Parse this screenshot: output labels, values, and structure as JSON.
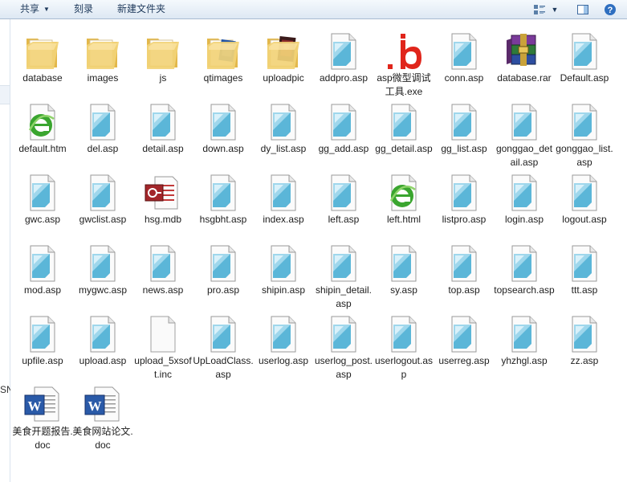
{
  "toolbar": {
    "share_label": "共享",
    "burn_label": "刻录",
    "new_folder_label": "新建文件夹"
  },
  "nav": {
    "fragment_text": "SN"
  },
  "files": [
    {
      "name": "database",
      "icon": "folder-icon"
    },
    {
      "name": "images",
      "icon": "folder-icon"
    },
    {
      "name": "js",
      "icon": "folder-icon"
    },
    {
      "name": "qtimages",
      "icon": "folder-image-icon"
    },
    {
      "name": "uploadpic",
      "icon": "folder-photo-icon"
    },
    {
      "name": "addpro.asp",
      "icon": "asp-file-icon"
    },
    {
      "name": "asp微型调试工具.exe",
      "icon": "exe-b-icon"
    },
    {
      "name": "conn.asp",
      "icon": "asp-file-icon"
    },
    {
      "name": "database.rar",
      "icon": "rar-archive-icon"
    },
    {
      "name": "Default.asp",
      "icon": "asp-file-icon"
    },
    {
      "name": "default.htm",
      "icon": "html-ie-icon"
    },
    {
      "name": "del.asp",
      "icon": "asp-file-icon"
    },
    {
      "name": "detail.asp",
      "icon": "asp-file-icon"
    },
    {
      "name": "down.asp",
      "icon": "asp-file-icon"
    },
    {
      "name": "dy_list.asp",
      "icon": "asp-file-icon"
    },
    {
      "name": "gg_add.asp",
      "icon": "asp-file-icon"
    },
    {
      "name": "gg_detail.asp",
      "icon": "asp-file-icon"
    },
    {
      "name": "gg_list.asp",
      "icon": "asp-file-icon"
    },
    {
      "name": "gonggao_detail.asp",
      "icon": "asp-file-icon"
    },
    {
      "name": "gonggao_list.asp",
      "icon": "asp-file-icon"
    },
    {
      "name": "gwc.asp",
      "icon": "asp-file-icon"
    },
    {
      "name": "gwclist.asp",
      "icon": "asp-file-icon"
    },
    {
      "name": "hsg.mdb",
      "icon": "access-mdb-icon"
    },
    {
      "name": "hsgbht.asp",
      "icon": "asp-file-icon"
    },
    {
      "name": "index.asp",
      "icon": "asp-file-icon"
    },
    {
      "name": "left.asp",
      "icon": "asp-file-icon"
    },
    {
      "name": "left.html",
      "icon": "html-ie-icon"
    },
    {
      "name": "listpro.asp",
      "icon": "asp-file-icon"
    },
    {
      "name": "login.asp",
      "icon": "asp-file-icon"
    },
    {
      "name": "logout.asp",
      "icon": "asp-file-icon"
    },
    {
      "name": "mod.asp",
      "icon": "asp-file-icon"
    },
    {
      "name": "mygwc.asp",
      "icon": "asp-file-icon"
    },
    {
      "name": "news.asp",
      "icon": "asp-file-icon"
    },
    {
      "name": "pro.asp",
      "icon": "asp-file-icon"
    },
    {
      "name": "shipin.asp",
      "icon": "asp-file-icon"
    },
    {
      "name": "shipin_detail.asp",
      "icon": "asp-file-icon"
    },
    {
      "name": "sy.asp",
      "icon": "asp-file-icon"
    },
    {
      "name": "top.asp",
      "icon": "asp-file-icon"
    },
    {
      "name": "topsearch.asp",
      "icon": "asp-file-icon"
    },
    {
      "name": "ttt.asp",
      "icon": "asp-file-icon"
    },
    {
      "name": "upfile.asp",
      "icon": "asp-file-icon"
    },
    {
      "name": "upload.asp",
      "icon": "asp-file-icon"
    },
    {
      "name": "upload_5xsoft.inc",
      "icon": "blank-file-icon"
    },
    {
      "name": "UpLoadClass.asp",
      "icon": "asp-file-icon"
    },
    {
      "name": "userlog.asp",
      "icon": "asp-file-icon"
    },
    {
      "name": "userlog_post.asp",
      "icon": "asp-file-icon"
    },
    {
      "name": "userlogout.asp",
      "icon": "asp-file-icon"
    },
    {
      "name": "userreg.asp",
      "icon": "asp-file-icon"
    },
    {
      "name": "yhzhgl.asp",
      "icon": "asp-file-icon"
    },
    {
      "name": "zz.asp",
      "icon": "asp-file-icon"
    },
    {
      "name": "美食开题报告.doc",
      "icon": "word-doc-icon"
    },
    {
      "name": "美食网站论文.doc",
      "icon": "word-doc-icon"
    }
  ],
  "colors": {
    "toolbar_text": "#1e395b",
    "folder_yellow": "#f2d277",
    "asp_blue": "#5bb6d8",
    "exe_red": "#e0251b",
    "ie_green": "#3aa52f",
    "word_blue": "#2a5aa8"
  }
}
